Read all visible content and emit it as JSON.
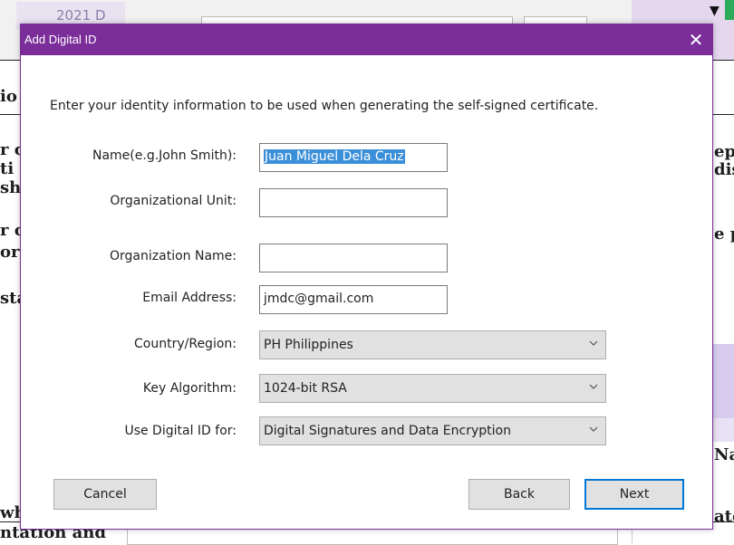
{
  "background": {
    "tab_text": "2021 D",
    "left_fragments": [
      "io",
      "r c",
      "ti",
      "sh",
      "r c",
      "or",
      "sta",
      "wh",
      "ntation and"
    ],
    "right_fragments": [
      "epr",
      "dis",
      "e p",
      "Na",
      "ate"
    ]
  },
  "dialog": {
    "title": "Add Digital ID",
    "close_symbol": "✕",
    "prompt": "Enter your identity information to be used when generating the self-signed certificate.",
    "fields": {
      "name": {
        "label": "Name(e.g.John Smith):",
        "value": "Juan Miguel Dela Cruz"
      },
      "org_unit": {
        "label": "Organizational Unit:",
        "value": ""
      },
      "org_name": {
        "label": "Organization Name:",
        "value": ""
      },
      "email": {
        "label": "Email Address:",
        "value": "jmdc@gmail.com"
      },
      "country": {
        "label": "Country/Region:",
        "value": "PH Philippines"
      },
      "key_algorithm": {
        "label": "Key Algorithm:",
        "value": "1024-bit RSA"
      },
      "use_for": {
        "label": "Use Digital ID for:",
        "value": "Digital Signatures and Data Encryption"
      }
    },
    "buttons": {
      "cancel": "Cancel",
      "back": "Back",
      "next": "Next"
    }
  },
  "colors": {
    "titlebar": "#7b2e9a",
    "selection": "#3b8fd9",
    "focus_border": "#0078d7"
  },
  "icons": [
    "close-icon",
    "chevron-down-icon"
  ]
}
